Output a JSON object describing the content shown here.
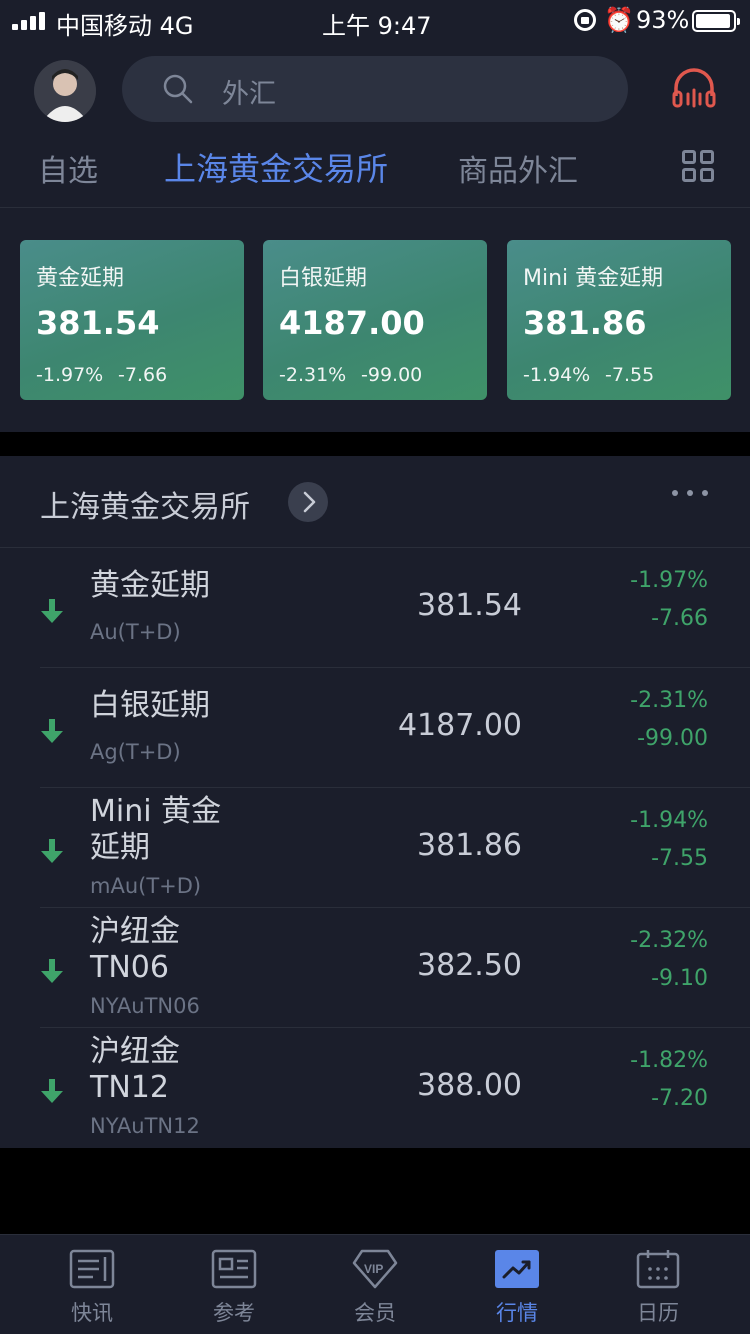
{
  "status_bar": {
    "carrier": "中国移动  4G",
    "time": "上午 9:47",
    "battery": "93%"
  },
  "search": {
    "placeholder": "外汇"
  },
  "tabs": [
    {
      "label": "自选"
    },
    {
      "label": "上海黄金交易所",
      "active": true
    },
    {
      "label": "商品外汇"
    }
  ],
  "cards": [
    {
      "name": "黄金延期",
      "price": "381.54",
      "pct": "-1.97%",
      "chg": "-7.66"
    },
    {
      "name": "白银延期",
      "price": "4187.00",
      "pct": "-2.31%",
      "chg": "-99.00"
    },
    {
      "name": "Mini 黄金延期",
      "price": "381.86",
      "pct": "-1.94%",
      "chg": "-7.55"
    }
  ],
  "section": {
    "title": "上海黄金交易所"
  },
  "rows": [
    {
      "name": "黄金延期",
      "code": "Au(T+D)",
      "price": "381.54",
      "pct": "-1.97%",
      "chg": "-7.66"
    },
    {
      "name": "白银延期",
      "code": "Ag(T+D)",
      "price": "4187.00",
      "pct": "-2.31%",
      "chg": "-99.00"
    },
    {
      "name": "Mini 黄金延期",
      "code": "mAu(T+D)",
      "price": "381.86",
      "pct": "-1.94%",
      "chg": "-7.55"
    },
    {
      "name": "沪纽金 TN06",
      "code": "NYAuTN06",
      "price": "382.50",
      "pct": "-2.32%",
      "chg": "-9.10"
    },
    {
      "name": "沪纽金 TN12",
      "code": "NYAuTN12",
      "price": "388.00",
      "pct": "-1.82%",
      "chg": "-7.20"
    }
  ],
  "tabbar": [
    {
      "label": "快讯",
      "icon": "news-icon"
    },
    {
      "label": "参考",
      "icon": "reference-icon"
    },
    {
      "label": "会员",
      "icon": "vip-icon"
    },
    {
      "label": "行情",
      "icon": "market-icon",
      "active": true
    },
    {
      "label": "日历",
      "icon": "calendar-icon"
    }
  ],
  "colors": {
    "accent": "#5a86e8",
    "down": "#3fa46a",
    "card": "#3d8670",
    "background": "#1b1e2b"
  }
}
